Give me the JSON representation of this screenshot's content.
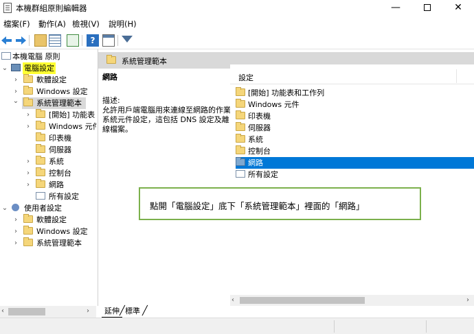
{
  "window": {
    "title": "本機群組原則編輯器",
    "minimize": "—",
    "close": "✕"
  },
  "menubar": {
    "file": "檔案(F)",
    "action": "動作(A)",
    "view": "檢視(V)",
    "help": "說明(H)"
  },
  "toolbar": {
    "help_label": "?"
  },
  "tree": {
    "root": "本機電腦 原則",
    "computer_config": "電腦設定",
    "cc_software": "軟體設定",
    "cc_windows": "Windows 設定",
    "cc_admin": "系統管理範本",
    "cc_admin_start": "[開始] 功能表",
    "cc_admin_windows": "Windows 元件",
    "cc_admin_printers": "印表機",
    "cc_admin_servers": "伺服器",
    "cc_admin_system": "系統",
    "cc_admin_control": "控制台",
    "cc_admin_network": "網路",
    "cc_admin_all": "所有設定",
    "user_config": "使用者設定",
    "uc_software": "軟體設定",
    "uc_windows": "Windows 設定",
    "uc_admin": "系統管理範本"
  },
  "right": {
    "header": "系統管理範本",
    "desc_title": "網路",
    "desc_label": "描述:",
    "desc_text": "允許用戶端電腦用來連線至網路的作業系統元件設定，這包括 DNS 設定及離線檔案。",
    "column": "設定",
    "items": [
      "[開始] 功能表和工作列",
      "Windows 元件",
      "印表機",
      "伺服器",
      "系統",
      "控制台",
      "網路",
      "所有設定"
    ]
  },
  "tabs": {
    "extended": "延伸",
    "standard": "標準"
  },
  "annotation": {
    "text": "點開「電腦設定」底下「系統管理範本」裡面的「網路」"
  },
  "colors": {
    "highlight": "#ffff33",
    "selection": "#0078d7",
    "callout_border": "#7bb04b"
  }
}
